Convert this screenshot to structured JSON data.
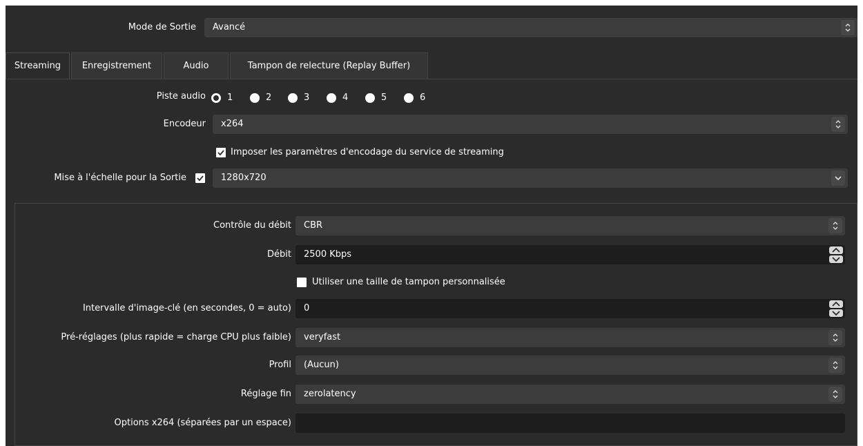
{
  "output_mode": {
    "label": "Mode de Sortie",
    "value": "Avancé"
  },
  "tabs": [
    {
      "label": "Streaming",
      "active": true
    },
    {
      "label": "Enregistrement",
      "active": false
    },
    {
      "label": "Audio",
      "active": false
    },
    {
      "label": "Tampon de relecture (Replay Buffer)",
      "active": false
    }
  ],
  "audio_track": {
    "label": "Piste audio",
    "options": [
      "1",
      "2",
      "3",
      "4",
      "5",
      "6"
    ],
    "selected": "1"
  },
  "encoder": {
    "label": "Encodeur",
    "value": "x264"
  },
  "enforce_service": {
    "label": "Imposer les paramètres d'encodage du service de streaming",
    "checked": true
  },
  "rescale": {
    "label": "Mise à l'échelle pour la Sortie",
    "checked": true,
    "value": "1280x720"
  },
  "encoder_settings": {
    "rate_control": {
      "label": "Contrôle du débit",
      "value": "CBR"
    },
    "bitrate": {
      "label": "Débit",
      "value": "2500 Kbps"
    },
    "custom_buffer": {
      "label": "Utiliser une taille de tampon personnalisée",
      "checked": false
    },
    "keyframe_interval": {
      "label": "Intervalle d'image-clé (en secondes, 0 = auto)",
      "value": "0"
    },
    "preset": {
      "label": "Pré-réglages (plus rapide = charge CPU plus faible)",
      "value": "veryfast"
    },
    "profile": {
      "label": "Profil",
      "value": "(Aucun)"
    },
    "tune": {
      "label": "Réglage fin",
      "value": "zerolatency"
    },
    "x264_options": {
      "label": "Options x264 (séparées par un espace)",
      "value": ""
    }
  },
  "icons": {
    "combo_arrow": "updown-chevron-icon",
    "dropdown_arrow": "chevron-down-icon",
    "spin_arrows": "spinbox-arrows-icon",
    "checkmark": "checkmark-icon"
  },
  "colors": {
    "panel_bg": "#2b2b2b",
    "field_bg": "#3c3c3c",
    "input_bg": "#1d1d1d",
    "text": "#ffffff"
  }
}
